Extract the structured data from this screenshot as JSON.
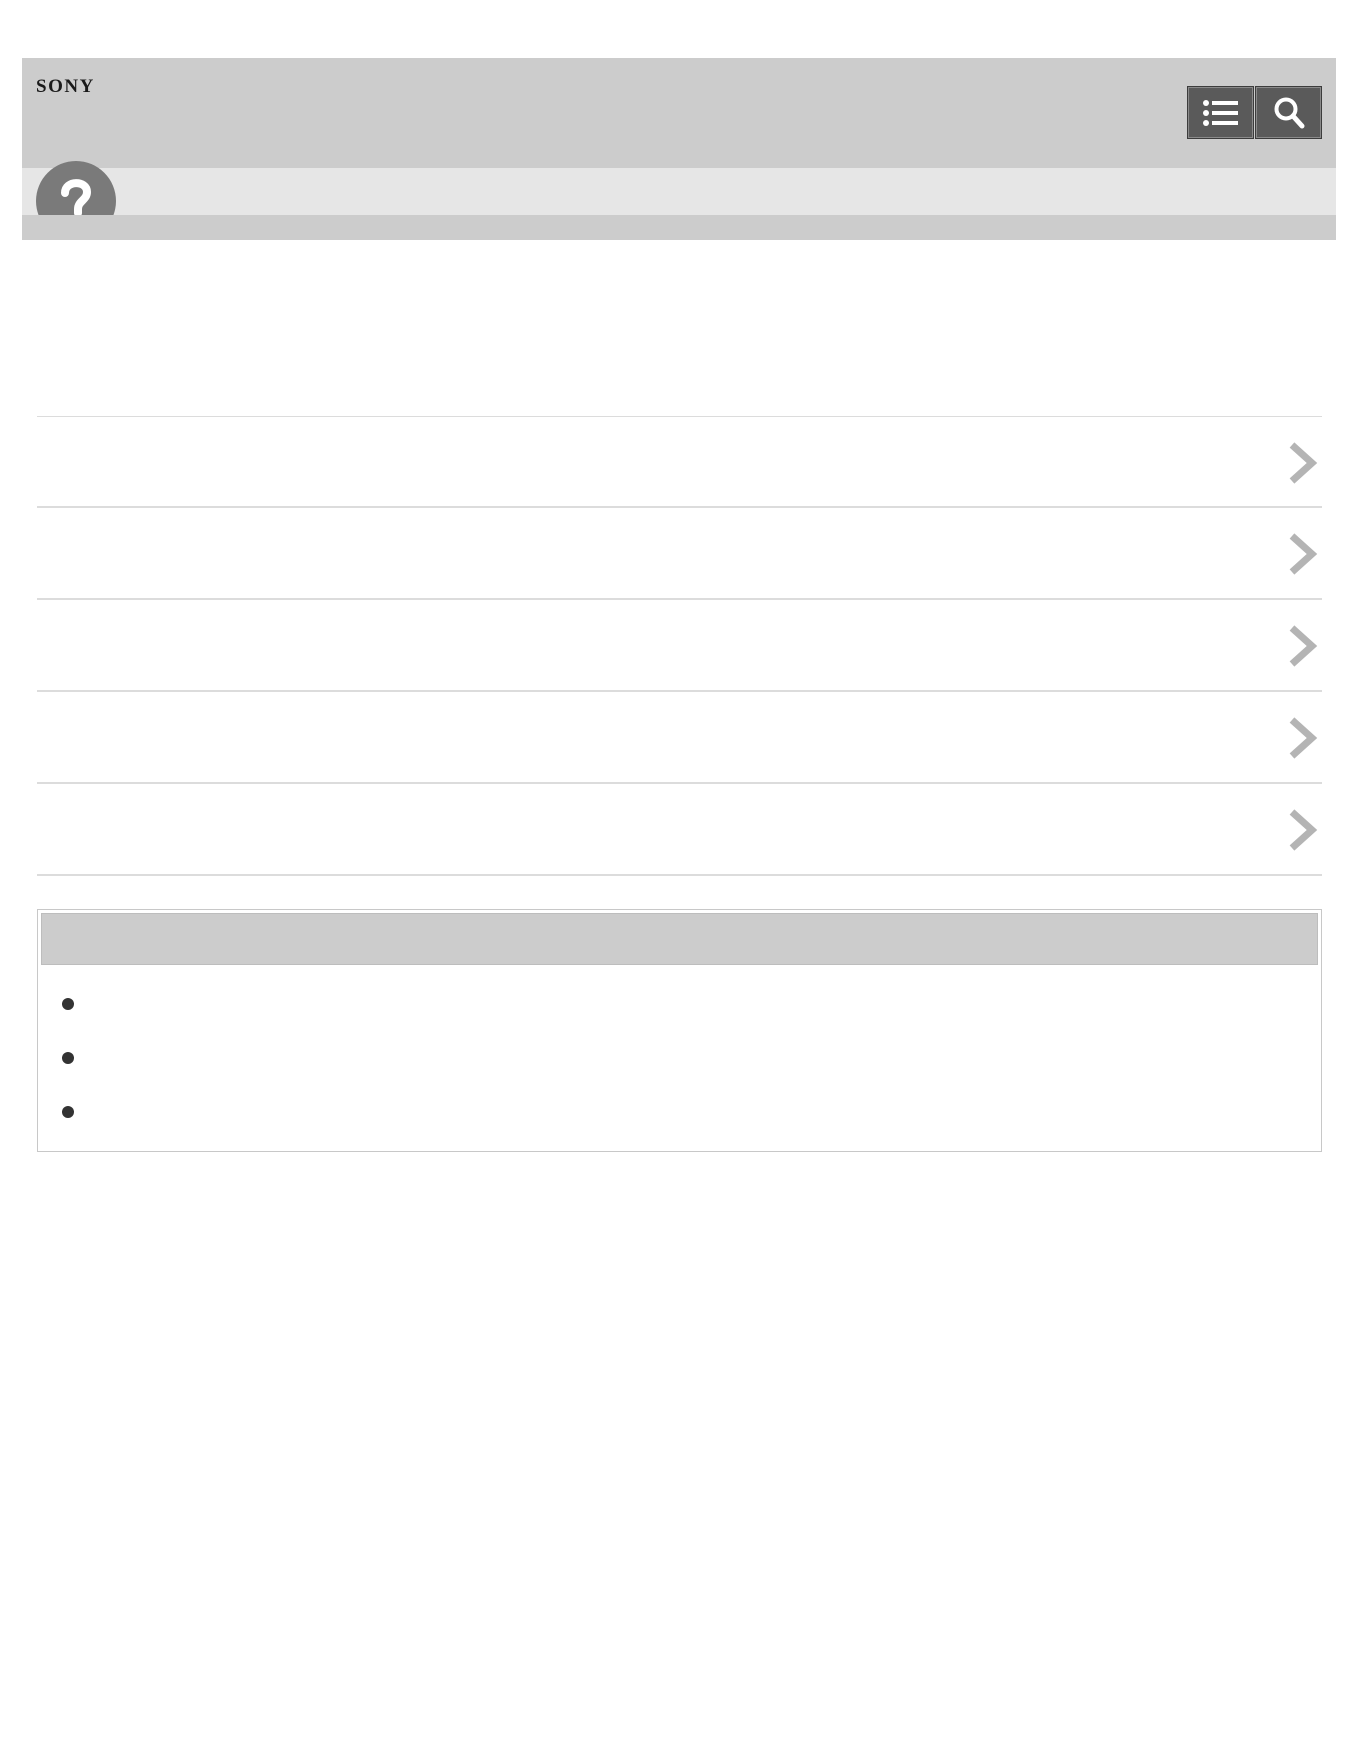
{
  "header": {
    "brand": "SONY",
    "toc_button_icon": "list-icon",
    "search_button_icon": "search-icon"
  },
  "subband": {
    "help_icon": "question-mark-icon",
    "title": ""
  },
  "list": {
    "items": [
      {
        "label": "",
        "icon": "chevron-right-icon"
      },
      {
        "label": "",
        "icon": "chevron-right-icon"
      },
      {
        "label": "",
        "icon": "chevron-right-icon"
      },
      {
        "label": "",
        "icon": "chevron-right-icon"
      },
      {
        "label": "",
        "icon": "chevron-right-icon"
      }
    ]
  },
  "note": {
    "title": "",
    "items": [
      {
        "text": ""
      },
      {
        "text": ""
      },
      {
        "text": ""
      }
    ]
  },
  "colors": {
    "header_bg": "#cccccc",
    "subband_bg": "#e6e6e6",
    "button_bg": "#5a5a5a",
    "icon_gray": "#7a7a7a",
    "chevron": "#b4b4b4",
    "divider": "#dcdcdc"
  }
}
